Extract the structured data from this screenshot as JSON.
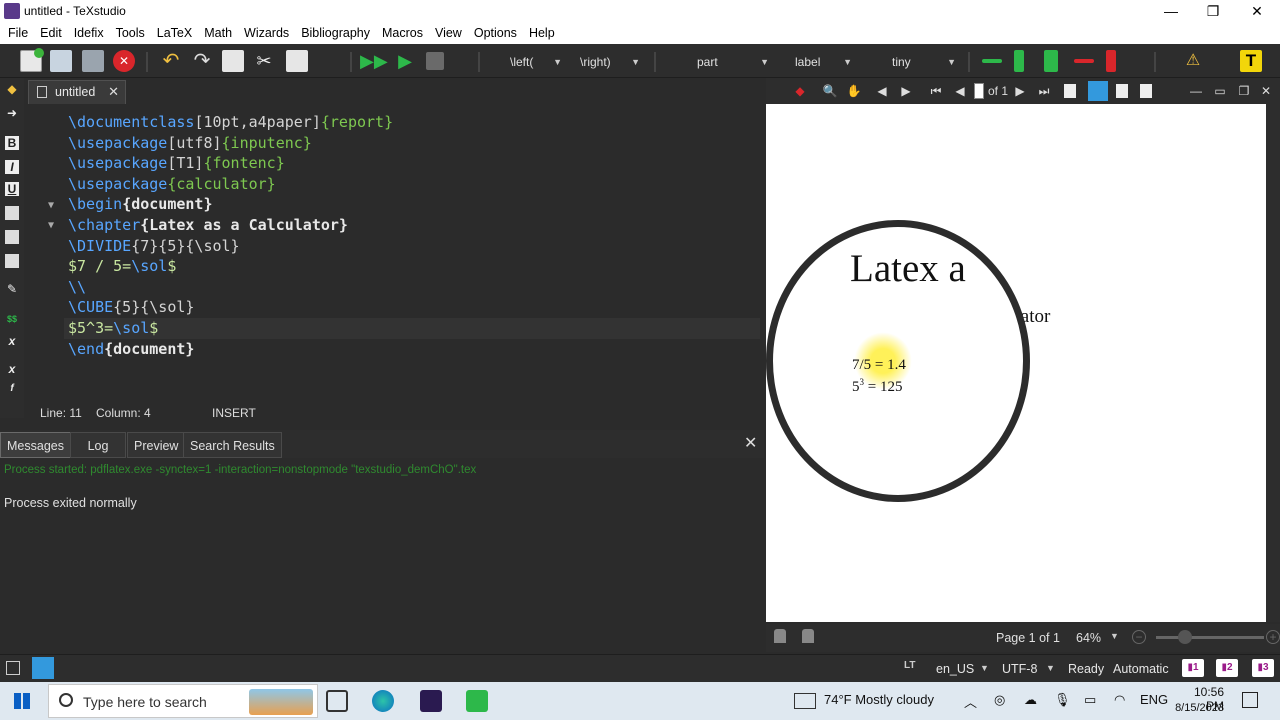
{
  "window": {
    "title": "untitled - TeXstudio"
  },
  "menu": [
    "File",
    "Edit",
    "Idefix",
    "Tools",
    "LaTeX",
    "Math",
    "Wizards",
    "Bibliography",
    "Macros",
    "View",
    "Options",
    "Help"
  ],
  "toolbar": {
    "left_combo": "\\left(",
    "right_combo": "\\right)",
    "part_combo": "part",
    "label_combo": "label",
    "size_combo": "tiny"
  },
  "editor": {
    "tab_name": "untitled",
    "lines": {
      "l1_cmd": "\\documentclass",
      "l1_opt": "[10pt,a4paper]",
      "l1_arg": "{report}",
      "l2_cmd": "\\usepackage",
      "l2_opt": "[utf8]",
      "l2_arg": "{inputenc}",
      "l3_cmd": "\\usepackage",
      "l3_opt": "[T1]",
      "l3_arg": "{fontenc}",
      "l4_cmd": "\\usepackage",
      "l4_arg": "{calculator}",
      "l5_cmd": "\\begin",
      "l5_arg": "{document}",
      "l6_cmd": "\\chapter",
      "l6_arg": "{Latex as a Calculator}",
      "l7_cmd": "\\DIVIDE",
      "l7_arg": "{7}{5}{\\sol}",
      "l8_math": "$7 / 5=",
      "l8_cmd": "\\sol",
      "l8_end": "$",
      "l9_cmd": "\\\\",
      "l10_cmd": "\\CUBE",
      "l10_arg": "{5}{\\sol}",
      "l11_math": "$5^3=",
      "l11_cmd": "\\sol",
      "l11_end": "$",
      "l12_cmd": "\\end",
      "l12_arg": "{document}"
    },
    "status": {
      "line": "Line: 11",
      "column": "Column: 4",
      "mode": "INSERT"
    }
  },
  "messages": {
    "tabs": [
      "Messages",
      "Log",
      "Preview",
      "Search Results"
    ],
    "process_started": "Process started: pdflatex.exe -synctex=1 -interaction=nonstopmode \"texstudio_demChO\".tex",
    "process_exited": "Process exited normally"
  },
  "pdf": {
    "page_of": "of 1",
    "chapter_visible": "Latex a",
    "chapter_tail": "ulator",
    "line1": "7/5 = 1.4",
    "line2_base": "5",
    "line2_sup": "3",
    "line2_rest": " = 125",
    "page_status": "Page 1 of 1",
    "zoom": "64%"
  },
  "statusbar": {
    "language": "en_US",
    "encoding": "UTF-8",
    "state": "Ready",
    "mode": "Automatic"
  },
  "taskbar": {
    "search_placeholder": "Type here to search",
    "weather": "74°F  Mostly cloudy",
    "lang": "ENG",
    "time": "10:56 PM",
    "date": "8/15/2023"
  },
  "colors": {
    "accent": "#3399dd",
    "keyword": "#58a6ff",
    "argument": "#7ec850",
    "run_green": "#2db84a",
    "stop_red": "#d9262b"
  }
}
